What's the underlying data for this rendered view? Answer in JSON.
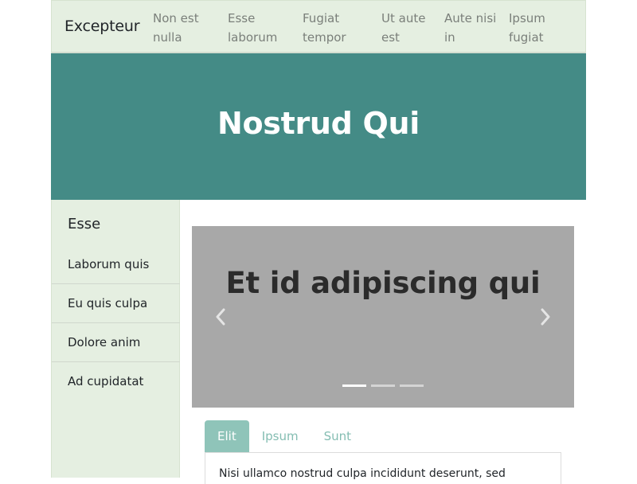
{
  "navbar": {
    "brand": "Excepteur",
    "items": [
      {
        "label": "Non est nulla"
      },
      {
        "label": "Esse laborum"
      },
      {
        "label": "Fugiat tempor"
      },
      {
        "label": "Ut aute est"
      },
      {
        "label": "Aute nisi in"
      },
      {
        "label": "Ipsum fugiat"
      }
    ]
  },
  "hero": {
    "title": "Nostrud Qui"
  },
  "sidebar": {
    "heading": "Esse",
    "items": [
      {
        "label": "Laborum quis"
      },
      {
        "label": "Eu quis culpa"
      },
      {
        "label": "Dolore anim"
      },
      {
        "label": "Ad cupidatat"
      }
    ]
  },
  "carousel": {
    "caption": "Et id adipiscing qui",
    "prev_icon": "chevron-left-icon",
    "next_icon": "chevron-right-icon",
    "slide_count": 3,
    "active_index": 0
  },
  "tabs": {
    "items": [
      {
        "label": "Elit",
        "active": true
      },
      {
        "label": "Ipsum",
        "active": false
      },
      {
        "label": "Sunt",
        "active": false
      }
    ],
    "panel_text": "Nisi ullamco nostrud culpa incididunt deserunt, sed"
  },
  "colors": {
    "navbar_bg": "#e5efe1",
    "hero_bg": "#448b86",
    "carousel_bg": "#a8a8a8",
    "tab_active_bg": "#8fc4b9",
    "tab_text": "#84bdb2"
  }
}
